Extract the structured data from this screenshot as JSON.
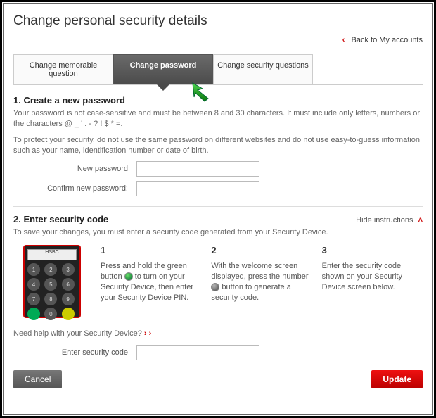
{
  "header": {
    "title": "Change personal security details"
  },
  "nav": {
    "back": "Back to My accounts"
  },
  "tabs": {
    "memorable": "Change memorable question",
    "password": "Change password",
    "questions": "Change security questions"
  },
  "section1": {
    "heading": "1. Create a new password",
    "p1": "Your password is not case-sensitive and must be between 8 and 30 characters. It must include only letters, numbers or the characters @ _ ' . - ? ! $ * =.",
    "p2": "To protect your security, do not use the same password on different websites and do not use easy-to-guess information such as your name, identification number or date of birth.",
    "new_label": "New password",
    "confirm_label": "Confirm new password:"
  },
  "section2": {
    "heading": "2. Enter security code",
    "hide": "Hide instructions",
    "intro": "To save your changes, you must enter a security code generated from your Security Device.",
    "device_brand": "HSBC",
    "steps": {
      "s1n": "1",
      "s1a": "Press and hold the green button ",
      "s1b": " to turn on your Security Device, then enter your Security Device PIN.",
      "s2n": "2",
      "s2a": "With the welcome screen displayed, press the number ",
      "s2b": " button to generate a security code.",
      "s3n": "3",
      "s3": "Enter the security code shown on your Security Device screen below."
    },
    "help": "Need help with your Security Device?",
    "code_label": "Enter security code"
  },
  "buttons": {
    "cancel": "Cancel",
    "update": "Update"
  }
}
